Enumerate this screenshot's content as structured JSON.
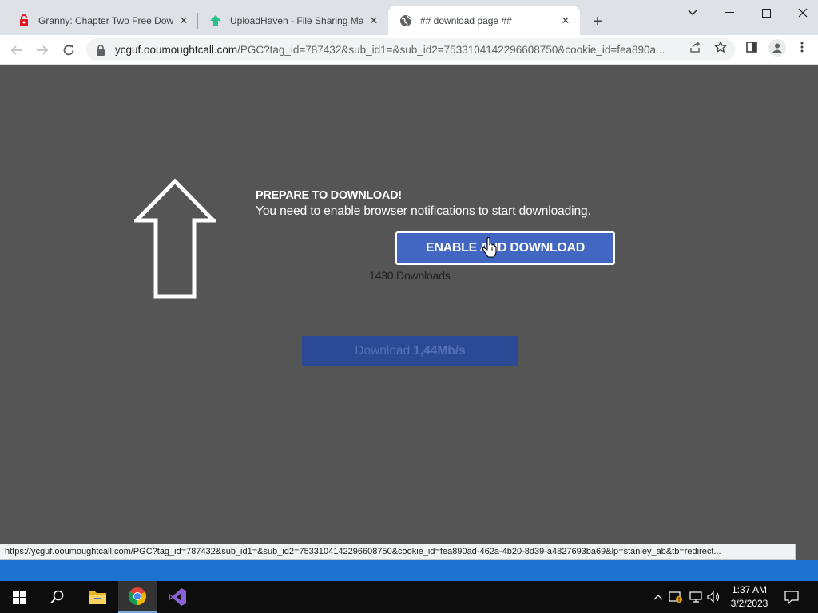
{
  "browser": {
    "tabs": [
      {
        "title": "Granny: Chapter Two Free Downl",
        "icon": "granny-favicon"
      },
      {
        "title": "UploadHaven - File Sharing Mad",
        "icon": "uploadhaven-favicon"
      },
      {
        "title": "## download page ##",
        "icon": "globe-icon",
        "active": true
      }
    ],
    "address": {
      "domain": "ycguf.ooumoughtcall.com",
      "path": "/PGC?tag_id=787432&sub_id1=&sub_id2=7533104142296608750&cookie_id=fea890a..."
    }
  },
  "page": {
    "heading": "PREPARE TO DOWNLOAD!",
    "subtext": "You need to enable browser notifications to start downloading.",
    "enable_button": "ENABLE AND DOWNLOAD",
    "downloads_count": "1430 Downloads",
    "download_button_prefix": "Download",
    "download_button_speed": "1,44Mb/s"
  },
  "status_url": "https://ycguf.ooumoughtcall.com/PGC?tag_id=787432&sub_id1=&sub_id2=7533104142296608750&cookie_id=fea890ad-462a-4b20-8d39-a4827693ba69&lp=stanley_ab&tb=redirect...",
  "taskbar": {
    "time": "1:37 AM",
    "date": "3/2/2023"
  },
  "colors": {
    "page_bg": "#555555",
    "enable_button": "#4267c3",
    "download_button": "#2c4a93",
    "taskbar": "#0d0d0d",
    "strip": "#1e73d0"
  }
}
